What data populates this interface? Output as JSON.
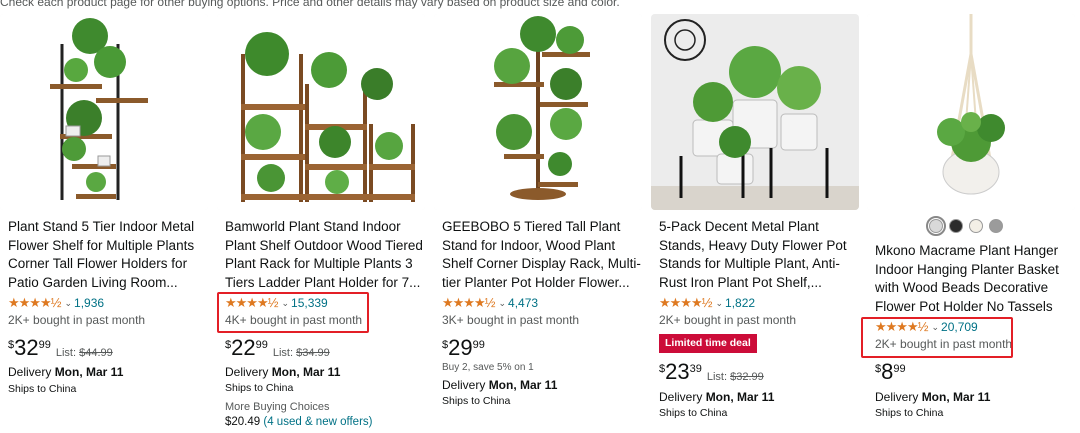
{
  "notice": "Check each product page for other buying options. Price and other details may vary based on product size and color.",
  "products": [
    {
      "title": "Plant Stand 5 Tier Indoor Metal Flower Shelf for Multiple Plants Corner Tall Flower Holders for Patio Garden Living Room...",
      "stars": "★★★★½",
      "rating_count": "1,936",
      "bought": "2K+ bought in past month",
      "currency": "$",
      "price_whole": "32",
      "price_frac": "99",
      "list_label": "List: ",
      "list_price": "$44.99",
      "delivery_label": "Delivery ",
      "delivery_date": "Mon, Mar 11",
      "ships": "Ships to China"
    },
    {
      "title": "Bamworld Plant Stand Indoor Plant Shelf Outdoor Wood Tiered Plant Rack for Multiple Plants 3 Tiers Ladder Plant Holder for 7...",
      "stars": "★★★★½",
      "rating_count": "15,339",
      "bought": "4K+ bought in past month",
      "currency": "$",
      "price_whole": "22",
      "price_frac": "99",
      "list_label": "List: ",
      "list_price": "$34.99",
      "delivery_label": "Delivery ",
      "delivery_date": "Mon, Mar 11",
      "ships": "Ships to China",
      "more_label": "More Buying Choices",
      "offer_price": "$20.49",
      "offer_link": "(4 used & new offers)"
    },
    {
      "title": "GEEBOBO 5 Tiered Tall Plant Stand for Indoor, Wood Plant Shelf Corner Display Rack, Multi-tier Planter Pot Holder Flower...",
      "stars": "★★★★½",
      "rating_count": "4,473",
      "bought": "3K+ bought in past month",
      "currency": "$",
      "price_whole": "29",
      "price_frac": "99",
      "promo": "Buy 2, save 5% on 1",
      "delivery_label": "Delivery ",
      "delivery_date": "Mon, Mar 11",
      "ships": "Ships to China"
    },
    {
      "title": "5-Pack Decent Metal Plant Stands, Heavy Duty Flower Pot Stands for Multiple Plant, Anti-Rust Iron Plant Pot Shelf,...",
      "stars": "★★★★½",
      "rating_count": "1,822",
      "bought": "2K+ bought in past month",
      "deal_badge": "Limited time deal",
      "currency": "$",
      "price_whole": "23",
      "price_frac": "39",
      "list_label": "List: ",
      "list_price": "$32.99",
      "delivery_label": "Delivery ",
      "delivery_date": "Mon, Mar 11",
      "ships": "Ships to China"
    },
    {
      "title": "Mkono Macrame Plant Hanger Indoor Hanging Planter Basket with Wood Beads Decorative Flower Pot Holder No Tassels for...",
      "stars": "★★★★½",
      "rating_count": "20,709",
      "bought": "2K+ bought in past month",
      "currency": "$",
      "price_whole": "8",
      "price_frac": "99",
      "delivery_label": "Delivery ",
      "delivery_date": "Mon, Mar 11",
      "ships": "Ships to China",
      "swatches": [
        "#d9d9d9",
        "#2b2b2b",
        "#f3efe6",
        "#9b9b9b"
      ]
    }
  ],
  "colors": {
    "star": "#de7921",
    "link": "#007185",
    "highlight": "#e31f26",
    "deal": "#cc0c39"
  }
}
